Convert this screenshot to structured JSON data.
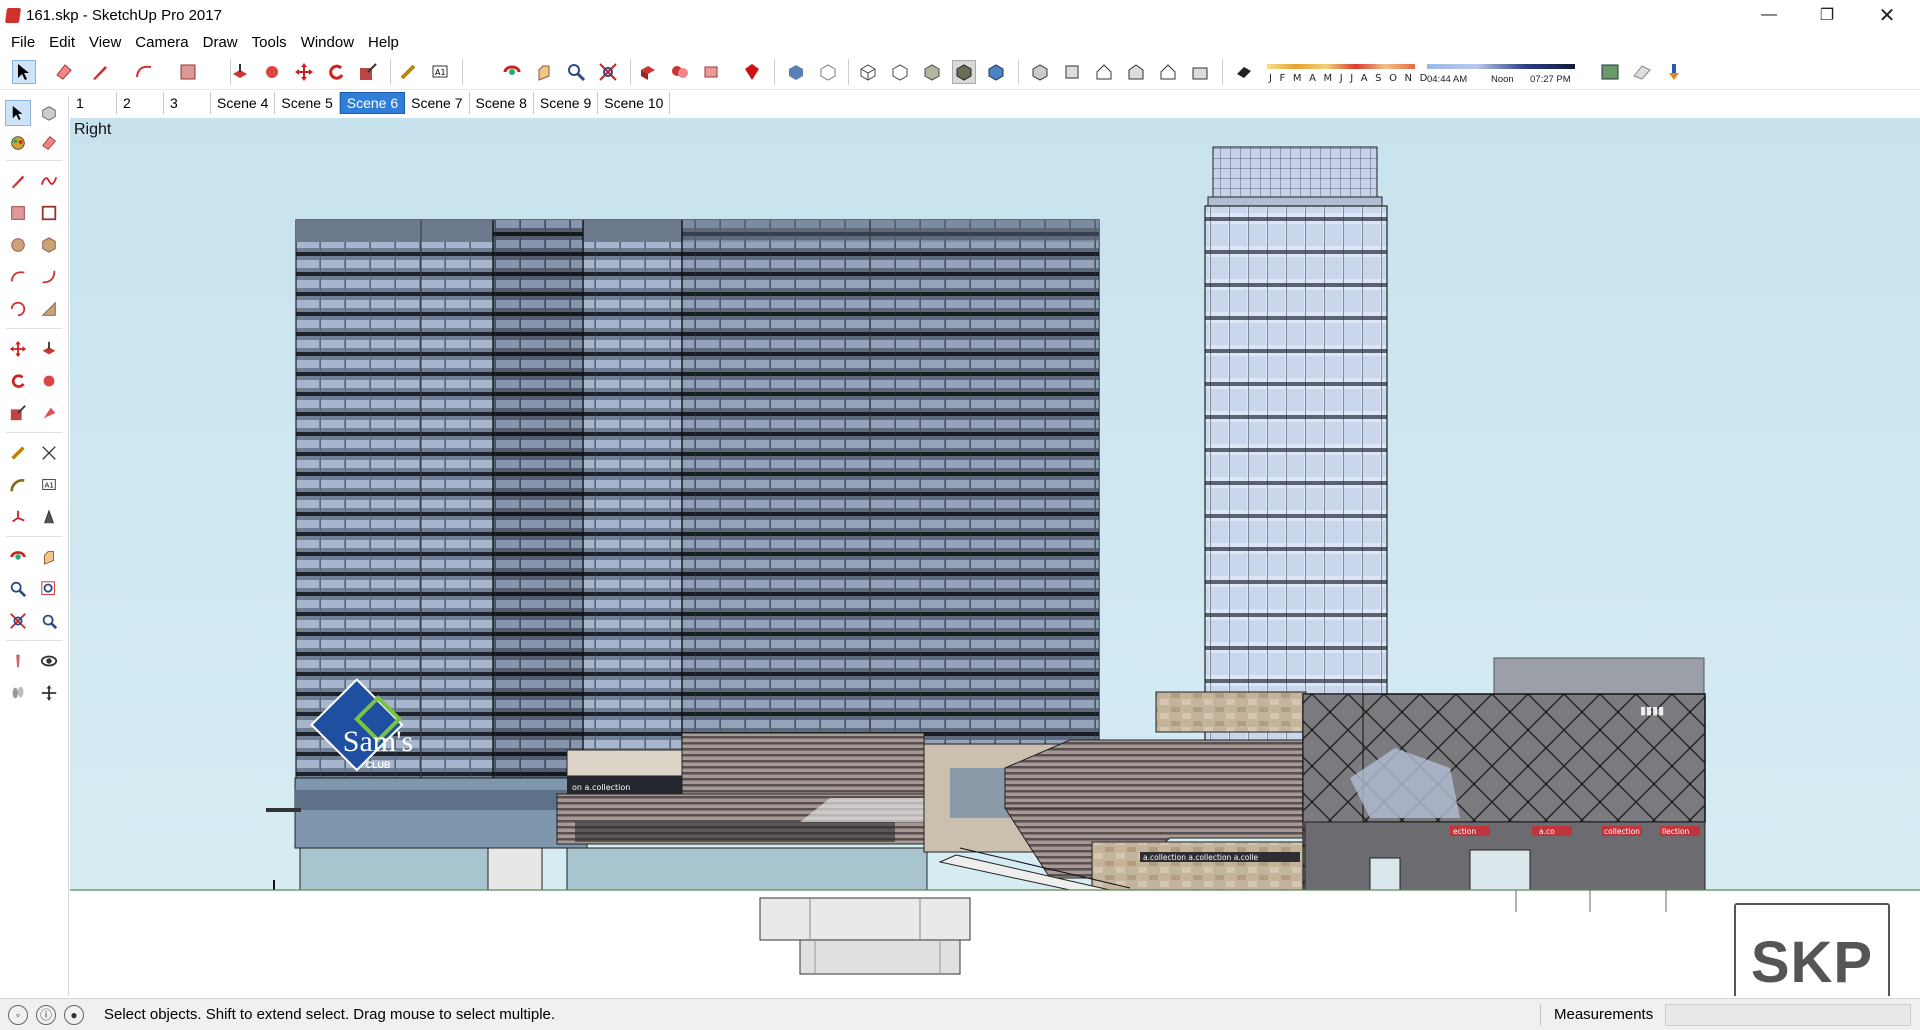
{
  "window": {
    "title": "161.skp - SketchUp Pro 2017",
    "minimize_glyph": "—",
    "maximize_glyph": "❐",
    "close_glyph": "✕"
  },
  "menu": [
    "File",
    "Edit",
    "View",
    "Camera",
    "Draw",
    "Tools",
    "Window",
    "Help"
  ],
  "shadow": {
    "months": "J F M A M J J A S O N D",
    "time_start": "04:44 AM",
    "time_mid": "Noon",
    "time_end": "07:27 PM"
  },
  "scenes": {
    "tabs": [
      "1",
      "2",
      "3",
      "Scene 4",
      "Scene 5",
      "Scene 6",
      "Scene 7",
      "Scene 8",
      "Scene 9",
      "Scene 10"
    ],
    "active": "Scene 6"
  },
  "viewport": {
    "view_label": "Right",
    "sams_club_main": "Sam's",
    "sams_club_sub": "CLUB",
    "sign_collection": "on a.collection",
    "sign_collection_2": "a.collection a.collection a.colle",
    "sign_ection": "ection",
    "sign_aco": "a.co",
    "sign_collection_3": "collection",
    "sign_llection": "llection",
    "skp_badge": "SKP"
  },
  "status": {
    "hint": "Select objects. Shift to extend select. Drag mouse to select multiple.",
    "measurements_label": "Measurements",
    "measurements_value": ""
  },
  "colors": {
    "sky": "#c8e3ee",
    "active_tab": "#2f7fd8",
    "sams_blue": "#1e4fa0"
  }
}
